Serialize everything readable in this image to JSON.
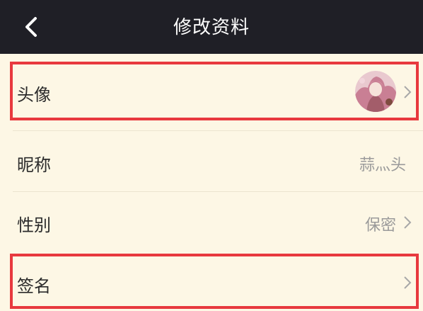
{
  "header": {
    "title": "修改资料",
    "back_icon": "chevron-left-icon"
  },
  "rows": [
    {
      "label": "头像",
      "value": "",
      "has_avatar": true,
      "chevron": true
    },
    {
      "label": "昵称",
      "value": "蒜灬头",
      "chevron": false
    },
    {
      "label": "性别",
      "value": "保密",
      "chevron": true
    },
    {
      "label": "签名",
      "value": "",
      "chevron": true
    }
  ],
  "colors": {
    "header_bg": "#1f1f26",
    "page_bg": "#fdf7e5",
    "highlight": "#e8393e",
    "value_text": "#9a9a9a"
  }
}
